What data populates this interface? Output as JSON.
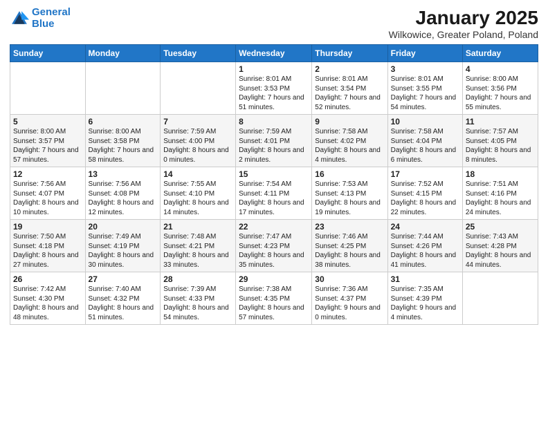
{
  "logo": {
    "line1": "General",
    "line2": "Blue"
  },
  "title": "January 2025",
  "subtitle": "Wilkowice, Greater Poland, Poland",
  "days_header": [
    "Sunday",
    "Monday",
    "Tuesday",
    "Wednesday",
    "Thursday",
    "Friday",
    "Saturday"
  ],
  "weeks": [
    [
      {
        "num": "",
        "info": ""
      },
      {
        "num": "",
        "info": ""
      },
      {
        "num": "",
        "info": ""
      },
      {
        "num": "1",
        "info": "Sunrise: 8:01 AM\nSunset: 3:53 PM\nDaylight: 7 hours and 51 minutes."
      },
      {
        "num": "2",
        "info": "Sunrise: 8:01 AM\nSunset: 3:54 PM\nDaylight: 7 hours and 52 minutes."
      },
      {
        "num": "3",
        "info": "Sunrise: 8:01 AM\nSunset: 3:55 PM\nDaylight: 7 hours and 54 minutes."
      },
      {
        "num": "4",
        "info": "Sunrise: 8:00 AM\nSunset: 3:56 PM\nDaylight: 7 hours and 55 minutes."
      }
    ],
    [
      {
        "num": "5",
        "info": "Sunrise: 8:00 AM\nSunset: 3:57 PM\nDaylight: 7 hours and 57 minutes."
      },
      {
        "num": "6",
        "info": "Sunrise: 8:00 AM\nSunset: 3:58 PM\nDaylight: 7 hours and 58 minutes."
      },
      {
        "num": "7",
        "info": "Sunrise: 7:59 AM\nSunset: 4:00 PM\nDaylight: 8 hours and 0 minutes."
      },
      {
        "num": "8",
        "info": "Sunrise: 7:59 AM\nSunset: 4:01 PM\nDaylight: 8 hours and 2 minutes."
      },
      {
        "num": "9",
        "info": "Sunrise: 7:58 AM\nSunset: 4:02 PM\nDaylight: 8 hours and 4 minutes."
      },
      {
        "num": "10",
        "info": "Sunrise: 7:58 AM\nSunset: 4:04 PM\nDaylight: 8 hours and 6 minutes."
      },
      {
        "num": "11",
        "info": "Sunrise: 7:57 AM\nSunset: 4:05 PM\nDaylight: 8 hours and 8 minutes."
      }
    ],
    [
      {
        "num": "12",
        "info": "Sunrise: 7:56 AM\nSunset: 4:07 PM\nDaylight: 8 hours and 10 minutes."
      },
      {
        "num": "13",
        "info": "Sunrise: 7:56 AM\nSunset: 4:08 PM\nDaylight: 8 hours and 12 minutes."
      },
      {
        "num": "14",
        "info": "Sunrise: 7:55 AM\nSunset: 4:10 PM\nDaylight: 8 hours and 14 minutes."
      },
      {
        "num": "15",
        "info": "Sunrise: 7:54 AM\nSunset: 4:11 PM\nDaylight: 8 hours and 17 minutes."
      },
      {
        "num": "16",
        "info": "Sunrise: 7:53 AM\nSunset: 4:13 PM\nDaylight: 8 hours and 19 minutes."
      },
      {
        "num": "17",
        "info": "Sunrise: 7:52 AM\nSunset: 4:15 PM\nDaylight: 8 hours and 22 minutes."
      },
      {
        "num": "18",
        "info": "Sunrise: 7:51 AM\nSunset: 4:16 PM\nDaylight: 8 hours and 24 minutes."
      }
    ],
    [
      {
        "num": "19",
        "info": "Sunrise: 7:50 AM\nSunset: 4:18 PM\nDaylight: 8 hours and 27 minutes."
      },
      {
        "num": "20",
        "info": "Sunrise: 7:49 AM\nSunset: 4:19 PM\nDaylight: 8 hours and 30 minutes."
      },
      {
        "num": "21",
        "info": "Sunrise: 7:48 AM\nSunset: 4:21 PM\nDaylight: 8 hours and 33 minutes."
      },
      {
        "num": "22",
        "info": "Sunrise: 7:47 AM\nSunset: 4:23 PM\nDaylight: 8 hours and 35 minutes."
      },
      {
        "num": "23",
        "info": "Sunrise: 7:46 AM\nSunset: 4:25 PM\nDaylight: 8 hours and 38 minutes."
      },
      {
        "num": "24",
        "info": "Sunrise: 7:44 AM\nSunset: 4:26 PM\nDaylight: 8 hours and 41 minutes."
      },
      {
        "num": "25",
        "info": "Sunrise: 7:43 AM\nSunset: 4:28 PM\nDaylight: 8 hours and 44 minutes."
      }
    ],
    [
      {
        "num": "26",
        "info": "Sunrise: 7:42 AM\nSunset: 4:30 PM\nDaylight: 8 hours and 48 minutes."
      },
      {
        "num": "27",
        "info": "Sunrise: 7:40 AM\nSunset: 4:32 PM\nDaylight: 8 hours and 51 minutes."
      },
      {
        "num": "28",
        "info": "Sunrise: 7:39 AM\nSunset: 4:33 PM\nDaylight: 8 hours and 54 minutes."
      },
      {
        "num": "29",
        "info": "Sunrise: 7:38 AM\nSunset: 4:35 PM\nDaylight: 8 hours and 57 minutes."
      },
      {
        "num": "30",
        "info": "Sunrise: 7:36 AM\nSunset: 4:37 PM\nDaylight: 9 hours and 0 minutes."
      },
      {
        "num": "31",
        "info": "Sunrise: 7:35 AM\nSunset: 4:39 PM\nDaylight: 9 hours and 4 minutes."
      },
      {
        "num": "",
        "info": ""
      }
    ]
  ]
}
